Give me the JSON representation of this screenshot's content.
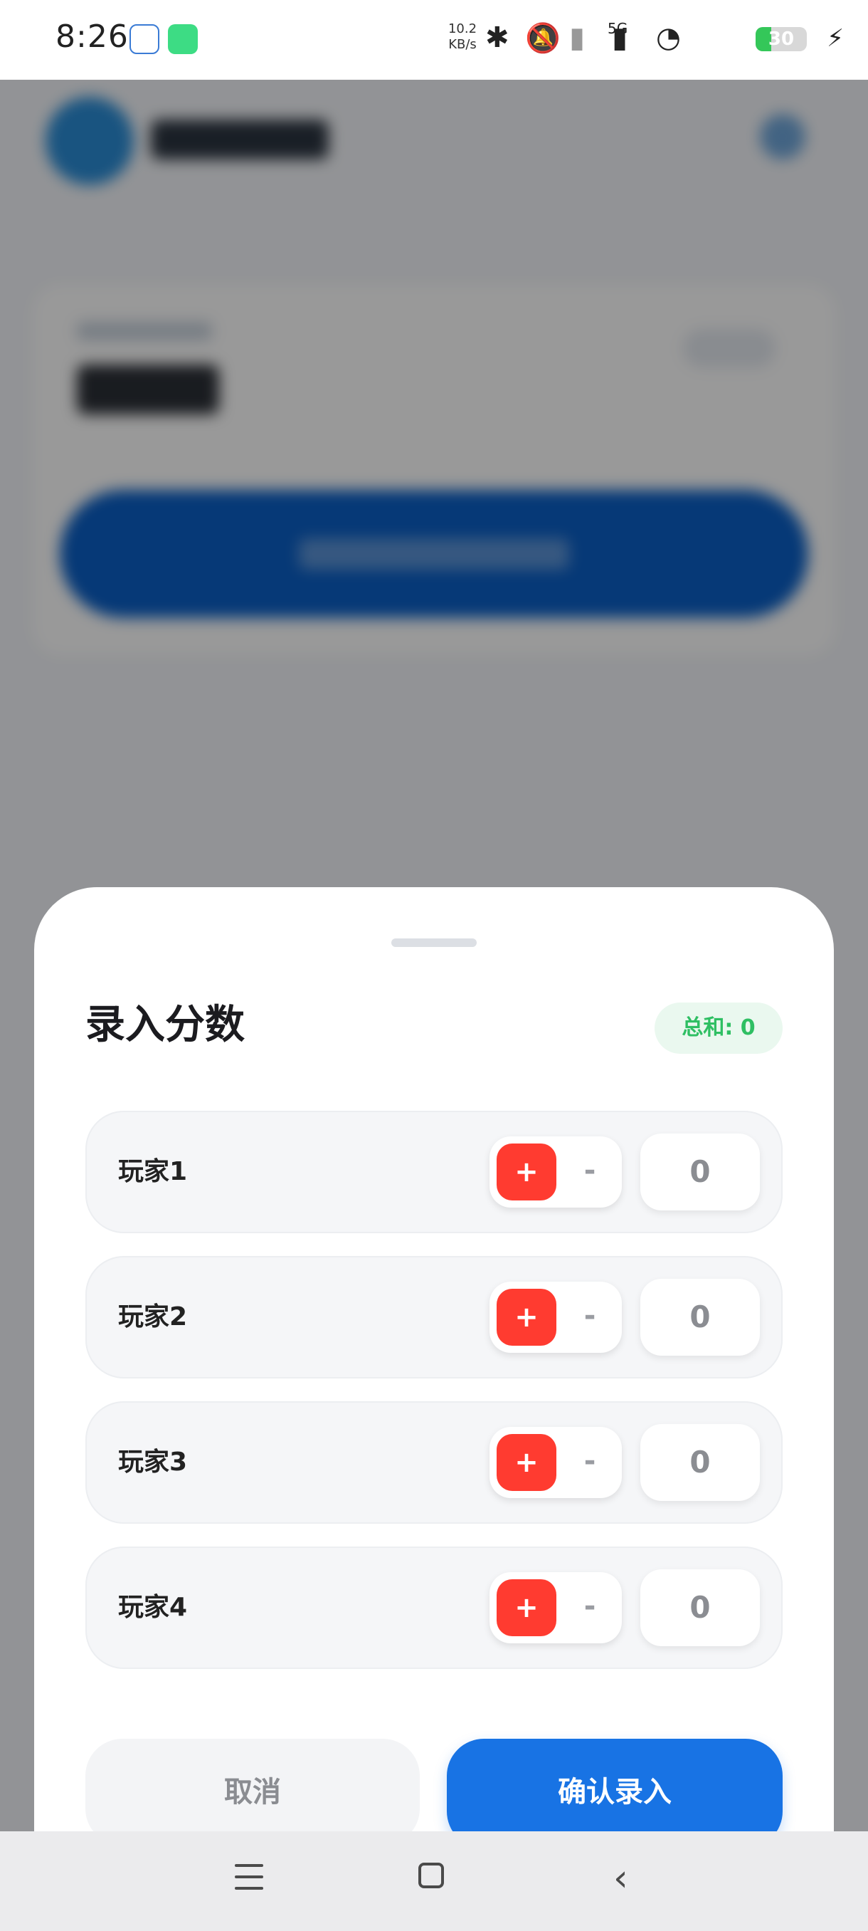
{
  "status_bar": {
    "time": "8:26",
    "net_speed_value": "10.2",
    "net_speed_unit": "KB/s",
    "network": "5G",
    "battery_level": "30"
  },
  "sheet": {
    "title": "录入分数",
    "sum_label": "总和: 0",
    "plus_label": "+",
    "minus_label": "-",
    "players": [
      {
        "name": "玩家1",
        "score": "0"
      },
      {
        "name": "玩家2",
        "score": "0"
      },
      {
        "name": "玩家3",
        "score": "0"
      },
      {
        "name": "玩家4",
        "score": "0"
      }
    ],
    "cancel_label": "取消",
    "confirm_label": "确认录入"
  },
  "colors": {
    "accent_blue": "#1873e4",
    "increment_red": "#ff3b30",
    "sum_green": "#2fbf63"
  },
  "icons": {
    "status": [
      "cloud-icon",
      "android-icon",
      "bluetooth-icon",
      "mute-icon",
      "signal-icon",
      "wifi-icon",
      "battery-icon",
      "charging-icon"
    ],
    "nav": [
      "menu-icon",
      "home-icon",
      "back-icon"
    ]
  }
}
